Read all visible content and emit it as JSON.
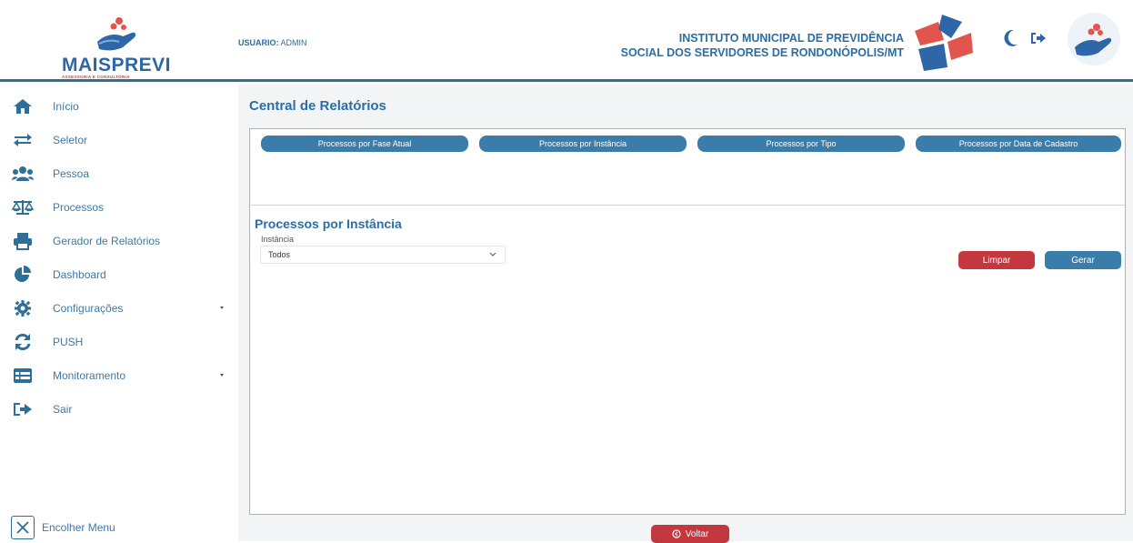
{
  "header": {
    "brand": "MAISPREVI",
    "brand_tagline": "ASSESSORIA E CONSULTORIA",
    "user_label": "USUARIO:",
    "user_name": "ADMIN",
    "institution_line1": "INSTITUTO MUNICIPAL DE PREVIDÊNCIA",
    "institution_line2": "SOCIAL DOS SERVIDORES DE RONDONÓPOLIS/MT",
    "icons": [
      "moon-icon",
      "logout-icon"
    ]
  },
  "sidebar": {
    "items": [
      {
        "label": "Início",
        "icon": "home-icon"
      },
      {
        "label": "Seletor",
        "icon": "exchange-icon"
      },
      {
        "label": "Pessoa",
        "icon": "users-icon"
      },
      {
        "label": "Processos",
        "icon": "balance-scale-icon"
      },
      {
        "label": "Gerador de Relatórios",
        "icon": "print-icon"
      },
      {
        "label": "Dashboard",
        "icon": "pie-chart-icon"
      },
      {
        "label": "Configurações",
        "icon": "gear-icon"
      },
      {
        "label": "PUSH",
        "icon": "sync-icon"
      },
      {
        "label": "Monitoramento",
        "icon": "table-icon"
      },
      {
        "label": "Sair",
        "icon": "sign-out-icon"
      }
    ],
    "collapse_label": "Encolher Menu"
  },
  "main": {
    "title": "Central de Relatórios",
    "tabs": [
      {
        "label": "Processos por Fase Atual"
      },
      {
        "label": "Processos por Instância"
      },
      {
        "label": "Processos por Tipo"
      },
      {
        "label": "Processos por Data de Cadastro"
      }
    ],
    "section_title": "Processos por Instância",
    "instance_label": "Instância",
    "instance_value": "Todos",
    "clear_label": "Limpar",
    "generate_label": "Gerar",
    "back_label": "Voltar"
  },
  "colors": {
    "primary": "#2a6ea3",
    "button_blue": "#3a7dab",
    "button_red": "#c4373f",
    "header_border": "#2d6f99"
  }
}
